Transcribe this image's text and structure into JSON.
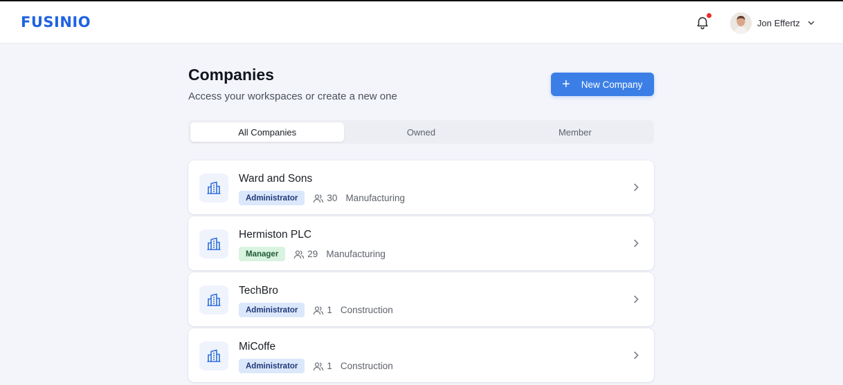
{
  "app": {
    "logo": "FUSINIO"
  },
  "header": {
    "user_name": "Jon Effertz",
    "has_notification": true
  },
  "page": {
    "title": "Companies",
    "subtitle": "Access your workspaces or create a new one",
    "new_button_label": "New Company"
  },
  "tabs": [
    {
      "label": "All Companies",
      "active": true
    },
    {
      "label": "Owned",
      "active": false
    },
    {
      "label": "Member",
      "active": false
    }
  ],
  "companies": [
    {
      "name": "Ward and Sons",
      "role": "Administrator",
      "members": "30",
      "industry": "Manufacturing"
    },
    {
      "name": "Hermiston PLC",
      "role": "Manager",
      "members": "29",
      "industry": "Manufacturing"
    },
    {
      "name": "TechBro",
      "role": "Administrator",
      "members": "1",
      "industry": "Construction"
    },
    {
      "name": "MiCoffe",
      "role": "Administrator",
      "members": "1",
      "industry": "Construction"
    }
  ],
  "colors": {
    "brand": "#1f63e0",
    "primary_button": "#3b7fe6",
    "notification_dot": "#ef2b2b",
    "admin_badge_bg": "#dbe7fb",
    "manager_badge_bg": "#d9f3e1"
  }
}
